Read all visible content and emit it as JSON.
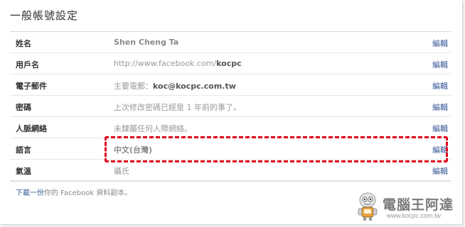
{
  "page": {
    "title": "一般帳號設定"
  },
  "rows": [
    {
      "label": "姓名",
      "value": "Shen Cheng Ta",
      "edit": "編輯"
    },
    {
      "label": "用戶名",
      "value": "http://www.facebook.com/",
      "value_bold": "kocpc",
      "edit": "編輯"
    },
    {
      "label": "電子郵件",
      "value": "主要電郵：",
      "value_bold": "koc@kocpc.com.tw",
      "edit": "編輯"
    },
    {
      "label": "密碼",
      "value": "上次修改密碼已經是 1 年前的事了。",
      "edit": "編輯"
    },
    {
      "label": "人脈網絡",
      "value": "未隸屬任何人際網絡。",
      "edit": "編輯"
    },
    {
      "label": "語言",
      "value": "中文(台灣)",
      "edit": "編輯"
    },
    {
      "label": "氣溫",
      "value": "攝氏",
      "edit": "編輯"
    }
  ],
  "download": {
    "link": "下載一份",
    "text": "你的 Facebook 資料副本。"
  },
  "watermark": {
    "title": "電腦王阿達",
    "url": "www.kocpc.com.tw"
  },
  "colors": {
    "link": "#3b5998",
    "highlight": "#e0001a"
  }
}
